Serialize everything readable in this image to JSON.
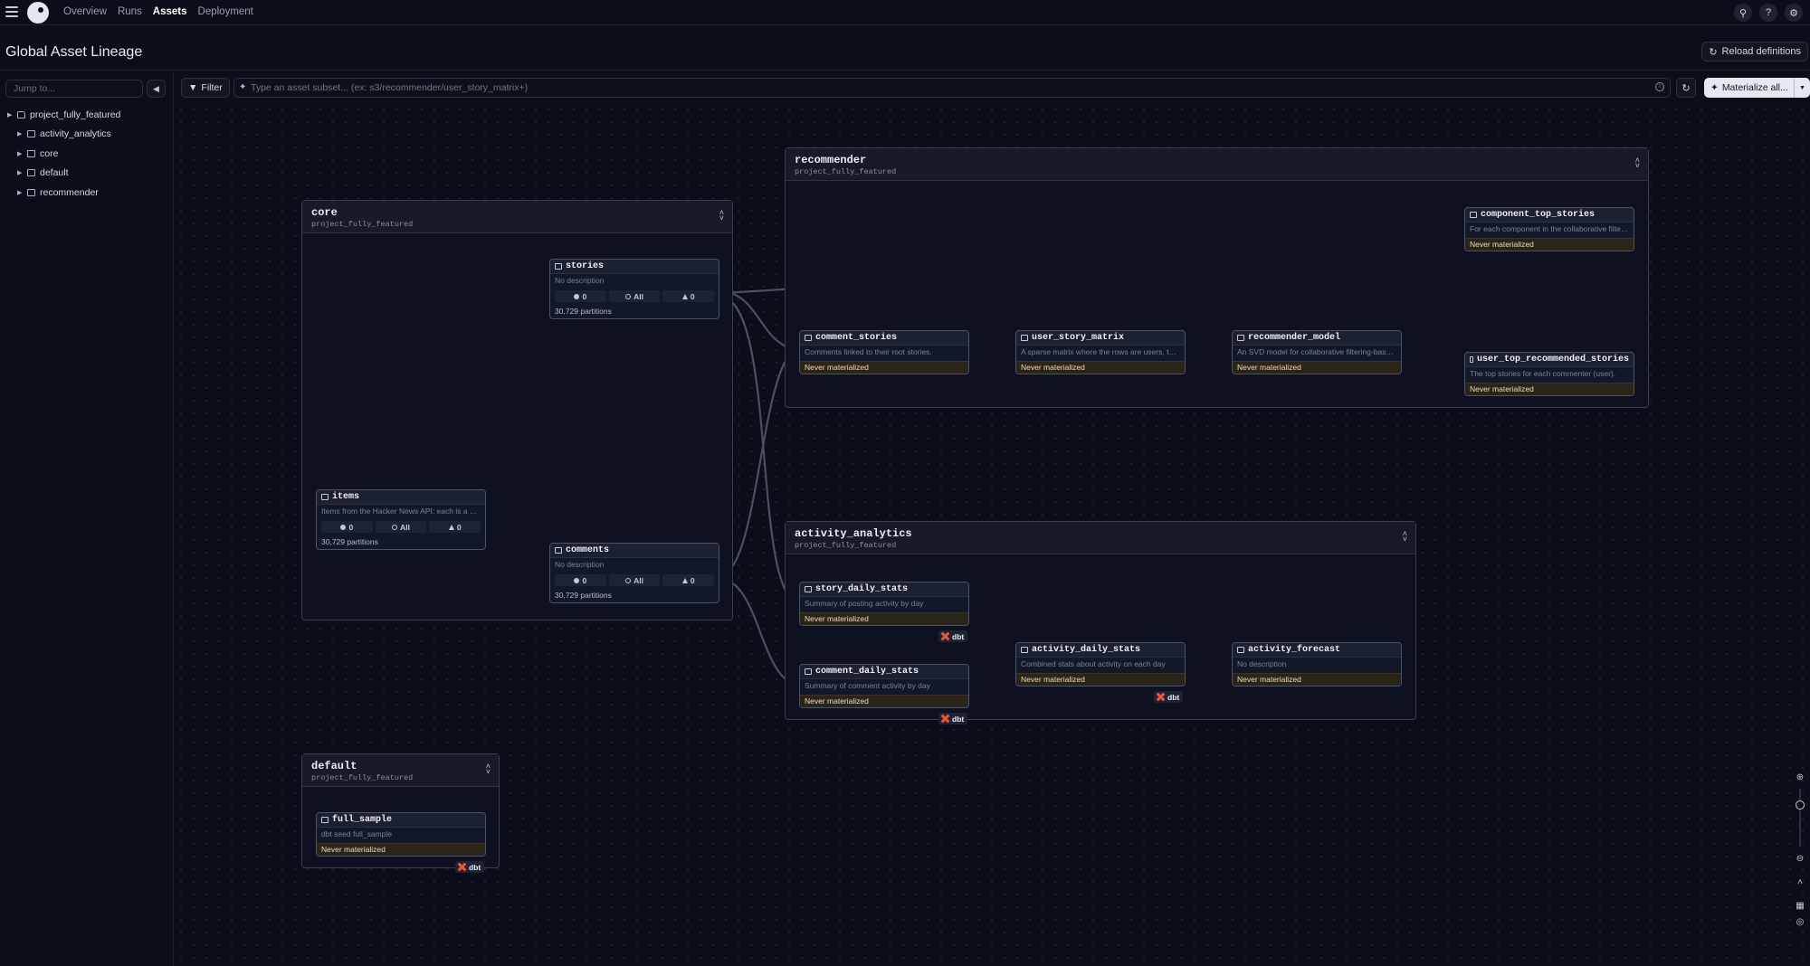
{
  "nav": {
    "items": [
      "Overview",
      "Runs",
      "Assets",
      "Deployment"
    ],
    "active": "Assets"
  },
  "header": {
    "title": "Global Asset Lineage",
    "reload_label": "Reload definitions"
  },
  "sidebar": {
    "jump_placeholder": "Jump to...",
    "tree": [
      {
        "label": "project_fully_featured",
        "level": 0,
        "kind": "folder"
      },
      {
        "label": "activity_analytics",
        "level": 1,
        "kind": "group"
      },
      {
        "label": "core",
        "level": 1,
        "kind": "group"
      },
      {
        "label": "default",
        "level": 1,
        "kind": "group"
      },
      {
        "label": "recommender",
        "level": 1,
        "kind": "group"
      }
    ]
  },
  "toolbar": {
    "filter_label": "Filter",
    "query_placeholder": "Type an asset subset... (ex: s3/recommender/user_story_matrix+)",
    "materialize_label": "Materialize all..."
  },
  "groups": {
    "core": {
      "name": "core",
      "location": "project_fully_featured"
    },
    "recommender": {
      "name": "recommender",
      "location": "project_fully_featured"
    },
    "activity_analytics": {
      "name": "activity_analytics",
      "location": "project_fully_featured"
    },
    "default": {
      "name": "default",
      "location": "project_fully_featured"
    }
  },
  "assets": {
    "stories": {
      "name": "stories",
      "description": "No description",
      "stats": [
        "0",
        "All",
        "0"
      ],
      "partitions": "30,729 partitions"
    },
    "items": {
      "name": "items",
      "description": "Items from the Hacker News API: each is a story or a comment on a story.",
      "stats": [
        "0",
        "All",
        "0"
      ],
      "partitions": "30,729 partitions"
    },
    "comments": {
      "name": "comments",
      "description": "No description",
      "stats": [
        "0",
        "All",
        "0"
      ],
      "partitions": "30,729 partitions"
    },
    "comment_stories": {
      "name": "comment_stories",
      "description": "Comments linked to their root stories.",
      "status": "Never materialized"
    },
    "user_story_matrix": {
      "name": "user_story_matrix",
      "description": "A sparse matrix where the rows are users, the columns are stories",
      "status": "Never materialized"
    },
    "recommender_model": {
      "name": "recommender_model",
      "description": "An SVD model for collaborative filtering-based recommendation.",
      "status": "Never materialized"
    },
    "component_top_stories": {
      "name": "component_top_stories",
      "description": "For each component in the collaborative filtering model, the titles",
      "status": "Never materialized"
    },
    "user_top_recommended_stories": {
      "name": "user_top_recommended_stories",
      "description": "The top stories for each commenter (user).",
      "status": "Never materialized"
    },
    "story_daily_stats": {
      "name": "story_daily_stats",
      "description": "Summary of posting activity by day",
      "status": "Never materialized"
    },
    "comment_daily_stats": {
      "name": "comment_daily_stats",
      "description": "Summary of comment activity by day",
      "status": "Never materialized"
    },
    "activity_daily_stats": {
      "name": "activity_daily_stats",
      "description": "Combined stats about activity on each day",
      "status": "Never materialized"
    },
    "activity_forecast": {
      "name": "activity_forecast",
      "description": "No description",
      "status": "Never materialized"
    },
    "full_sample": {
      "name": "full_sample",
      "description": "dbt seed full_sample",
      "status": "Never materialized"
    }
  },
  "badges": {
    "dbt": "dbt"
  },
  "colors": {
    "background": "#0b0d18",
    "node_border": "#4c5268",
    "status_bg": "#2b2418",
    "dbt": "#e8573a",
    "edge": "#4a4f62"
  },
  "icons": {
    "menu": "menu-icon",
    "search": "search-icon",
    "help": "help-icon",
    "settings": "gear-icon",
    "reload": "refresh-icon"
  }
}
